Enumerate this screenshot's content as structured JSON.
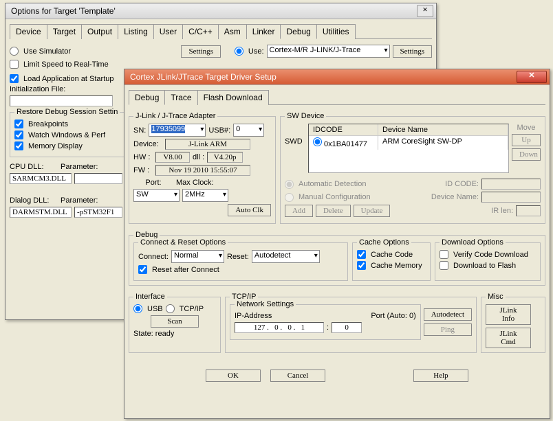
{
  "bgWindow": {
    "title": "Options for Target 'Template'",
    "tabs": [
      "Device",
      "Target",
      "Output",
      "Listing",
      "User",
      "C/C++",
      "Asm",
      "Linker",
      "Debug",
      "Utilities"
    ],
    "activeTab": 8,
    "useSimulator": "Use Simulator",
    "limitSpeed": "Limit Speed to Real-Time",
    "settings": "Settings",
    "use": "Use:",
    "useSel": "Cortex-M/R J-LINK/J-Trace",
    "loadApp": "Load Application at Startup",
    "initFile": "Initialization File:",
    "restoreGroup": "Restore Debug Session Settin",
    "breakpoints": "Breakpoints",
    "watchWindows": "Watch Windows & Perf",
    "memoryDisplay": "Memory Display",
    "cpuDll": "CPU DLL:",
    "parameter": "Parameter:",
    "cpuDllVal": "SARMCM3.DLL",
    "dialogDll": "Dialog DLL:",
    "dialogDllVal": "DARMSTM.DLL",
    "dialogParam": "-pSTM32F1"
  },
  "fgWindow": {
    "title": "Cortex JLink/JTrace Target Driver Setup",
    "tabs": [
      "Debug",
      "Trace",
      "Flash Download"
    ],
    "activeTab": 0,
    "adapter": {
      "title": "J-Link / J-Trace Adapter",
      "sn": "SN:",
      "snVal": "17935099",
      "usbNum": "USB#:",
      "usbNumVal": "0",
      "device": "Device:",
      "deviceVal": "J-Link ARM",
      "hw": "HW :",
      "hwVal": "V8.00",
      "dll": "dll :",
      "dllVal": "V4.20p",
      "fw": "FW :",
      "fwVal": "Nov 19 2010 15:55:07",
      "port": "Port:",
      "portVal": "SW",
      "maxClock": "Max Clock:",
      "maxClockVal": "2MHz",
      "autoClk": "Auto Clk"
    },
    "swDevice": {
      "title": "SW Device",
      "colId": "IDCODE",
      "colName": "Device Name",
      "swd": "SWD",
      "idcode": "0x1BA01477",
      "devname": "ARM CoreSight SW-DP",
      "move": "Move",
      "up": "Up",
      "down": "Down",
      "autoDetect": "Automatic Detection",
      "manualConfig": "Manual Configuration",
      "idCodeLbl": "ID CODE:",
      "devNameLbl": "Device Name:",
      "irLen": "IR len:",
      "add": "Add",
      "delete": "Delete",
      "update": "Update"
    },
    "debug": {
      "title": "Debug",
      "connReset": "Connect & Reset Options",
      "connect": "Connect:",
      "connectVal": "Normal",
      "reset": "Reset:",
      "resetVal": "Autodetect",
      "resetAfter": "Reset after Connect",
      "cache": "Cache Options",
      "cacheCode": "Cache Code",
      "cacheMem": "Cache Memory",
      "download": "Download Options",
      "verify": "Verify Code Download",
      "toFlash": "Download to Flash"
    },
    "interface": {
      "title": "Interface",
      "usb": "USB",
      "tcpip": "TCP/IP",
      "scan": "Scan",
      "state": "State: ready"
    },
    "tcpip": {
      "title": "TCP/IP",
      "netSettings": "Network Settings",
      "ipAddr": "IP-Address",
      "ip": "127 .   0 .   0 .   1",
      "port": "Port (Auto: 0)",
      "portVal": "0",
      "autodetect": "Autodetect",
      "ping": "Ping"
    },
    "misc": {
      "title": "Misc",
      "jlinkInfo": "JLink Info",
      "jlinkCmd": "JLink Cmd"
    },
    "ok": "OK",
    "cancel": "Cancel",
    "help": "Help"
  }
}
